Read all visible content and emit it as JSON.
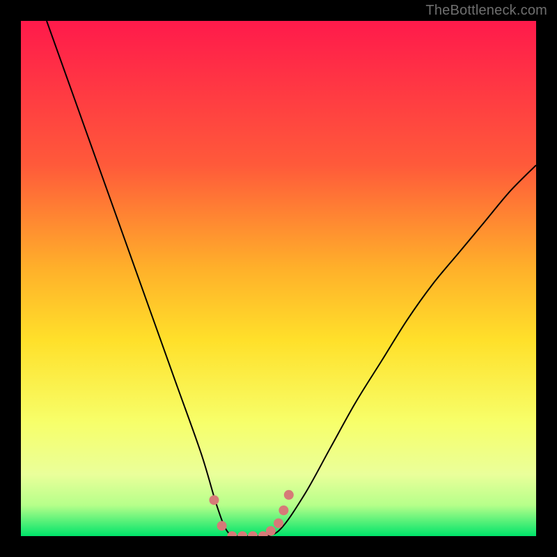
{
  "watermark": "TheBottleneck.com",
  "chart_data": {
    "type": "line",
    "title": "",
    "xlabel": "",
    "ylabel": "",
    "xlim": [
      0,
      100
    ],
    "ylim": [
      0,
      100
    ],
    "background_gradient": {
      "top": "#ff1a4b",
      "mid_upper": "#ff8a2a",
      "mid": "#ffe02a",
      "mid_lower": "#f7ff6a",
      "band": "#d7ff8a",
      "bottom": "#00e46a"
    },
    "series": [
      {
        "name": "bottleneck-curve",
        "color": "#000000",
        "stroke_width": 2,
        "x": [
          5,
          10,
          15,
          20,
          25,
          30,
          35,
          38,
          40,
          42,
          44,
          46,
          50,
          55,
          60,
          65,
          70,
          75,
          80,
          85,
          90,
          95,
          100
        ],
        "y": [
          100,
          86,
          72,
          58,
          44,
          30,
          16,
          6,
          1,
          0,
          0,
          0,
          1,
          8,
          17,
          26,
          34,
          42,
          49,
          55,
          61,
          67,
          72
        ]
      }
    ],
    "markers": {
      "name": "optimal-range-markers",
      "color": "#d67a78",
      "radius": 7,
      "points": [
        {
          "x": 37.5,
          "y": 7
        },
        {
          "x": 39.0,
          "y": 2
        },
        {
          "x": 41.0,
          "y": 0
        },
        {
          "x": 43.0,
          "y": 0
        },
        {
          "x": 45.0,
          "y": 0
        },
        {
          "x": 47.0,
          "y": 0
        },
        {
          "x": 48.5,
          "y": 1
        },
        {
          "x": 50.0,
          "y": 2.5
        },
        {
          "x": 51.0,
          "y": 5
        },
        {
          "x": 52.0,
          "y": 8
        }
      ]
    }
  }
}
